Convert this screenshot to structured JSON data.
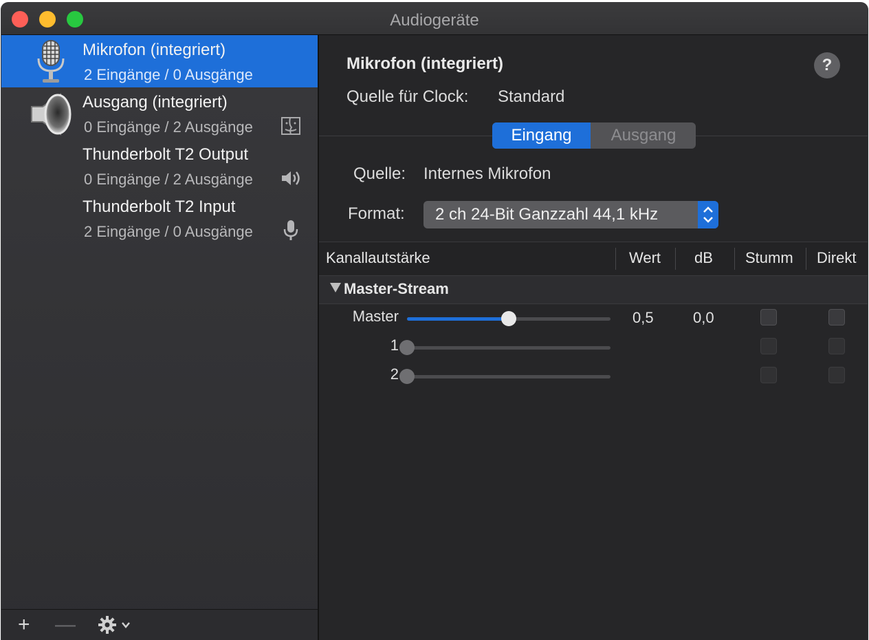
{
  "window": {
    "title": "Audiogeräte"
  },
  "devices": [
    {
      "name": "Mikrofon (integriert)",
      "io": "2 Eingänge / 0 Ausgänge",
      "icon": "microphone-icon",
      "badge": "",
      "selected": true
    },
    {
      "name": "Ausgang (integriert)",
      "io": "0 Eingänge / 2 Ausgänge",
      "icon": "speaker-icon",
      "badge": "finder-icon",
      "selected": false
    },
    {
      "name": "Thunderbolt T2 Output",
      "io": "0 Eingänge / 2 Ausgänge",
      "icon": "",
      "badge": "speaker-volume-icon",
      "selected": false
    },
    {
      "name": "Thunderbolt T2 Input",
      "io": "2 Eingänge / 0 Ausgänge",
      "icon": "",
      "badge": "microphone-small-icon",
      "selected": false
    }
  ],
  "footer": {
    "add": "+",
    "remove": "—"
  },
  "detail": {
    "device_name": "Mikrofon (integriert)",
    "clock_label": "Quelle für Clock:",
    "clock_value": "Standard",
    "help": "?",
    "tabs": [
      "Eingang",
      "Ausgang"
    ],
    "active_tab": "Eingang",
    "source_label": "Quelle:",
    "source_value": "Internes Mikrofon",
    "format_label": "Format:",
    "format_value": "2 ch 24-Bit Ganzzahl 44,1 kHz"
  },
  "table": {
    "headers": [
      "Kanallautstärke",
      "Wert",
      "dB",
      "Stumm",
      "Direkt"
    ],
    "stream": "Master-Stream",
    "rows": [
      {
        "name": "Master",
        "level": 0.5,
        "value": "0,5",
        "db": "0,0",
        "enabled": true
      },
      {
        "name": "1",
        "level": 0.0,
        "value": "",
        "db": "",
        "enabled": false
      },
      {
        "name": "2",
        "level": 0.0,
        "value": "",
        "db": "",
        "enabled": false
      }
    ]
  },
  "colors": {
    "accent": "#1e6fd9",
    "background": "#262628",
    "sidebar": "#343437"
  }
}
